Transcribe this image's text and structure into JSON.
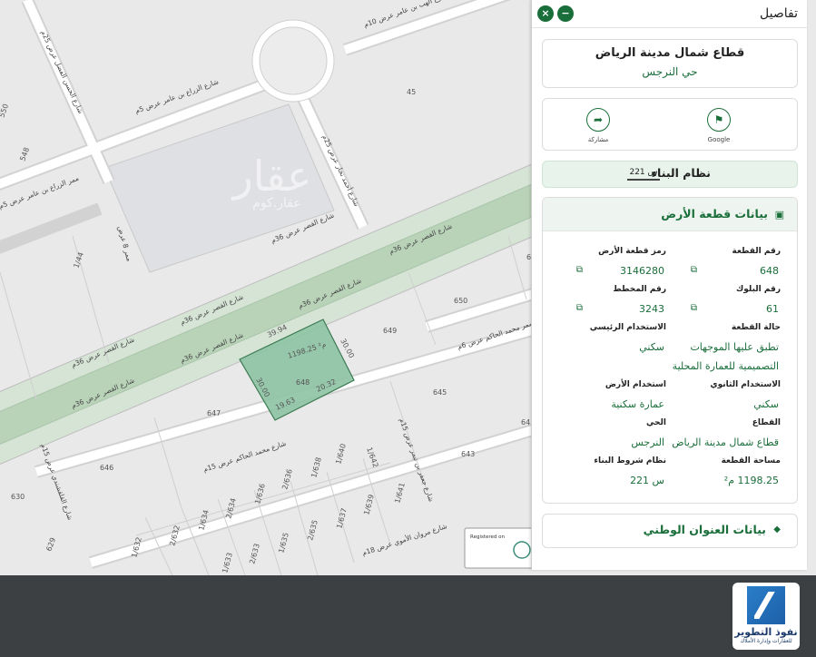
{
  "map": {
    "road_labels": {
      "qasr_1": "شارع القصر عرض 36م",
      "qasr_2": "شارع القصر عرض 36م",
      "qasr_3": "شارع القصر عرض 36م",
      "qasr_4": "شارع القصر عرض 36م",
      "qasr_5": "شارع القصر عرض 36م",
      "qasr_6": "شارع القصر عرض 36م",
      "qasr_7": "شارع القصر عرض 36م",
      "zarae_1": "شارع الزراع بن عامر عرض 5م",
      "zarae_2": "ممر الزراع بن عامر عرض 5م",
      "amir_10": "شارع الهب بن عامر عرض 10م",
      "hakim_1": "ممر محمد الحاكم عرض 6م",
      "hakim_15": "شارع محمد الحاكم عرض 15م",
      "ahmed_najar": "شارع أحمد نجار عرض 25م",
      "hassan_fadl": "شارع الحسن الفضل عرض 25م",
      "mamar_8": "ممر 8 عرض",
      "qalqashandi": "شارع القلقشندي عرض 15م",
      "jafar": "شارع جعفر بن تيمر عرض 15م",
      "marwan": "شارع مروان الأموي عرض 18م"
    },
    "plot_numbers": [
      "45",
      "550",
      "548",
      "1/44",
      "650",
      "649",
      "645",
      "643",
      "647",
      "646",
      "630",
      "629",
      "1/642",
      "1/640",
      "1/638",
      "2/636",
      "1/636",
      "1/634",
      "2/634",
      "1/632",
      "2/632",
      "1/633",
      "2/633",
      "1/635",
      "2/635",
      "1/637",
      "1/639",
      "1/641",
      "64",
      "63"
    ],
    "selected_parcel": {
      "number": "648",
      "area_label": "1198.25 م²",
      "dim_top": "39.94",
      "dim_right": "30.00",
      "dim_bottom": "20.32",
      "dim_bottom2": "19.63",
      "dim_left": "30.00"
    },
    "watermark": "عقار",
    "watermark_sub": "عقار.كوم",
    "badge_text": "Registered on"
  },
  "panel": {
    "title": "تفاصيل",
    "close_icon": "×",
    "minimize_icon": "−",
    "sector": "قطاع شمال مدينة الرياض",
    "district": "حي النرجس",
    "share_label": "مشاركة",
    "google_label": "Google",
    "building_system_label": "نظام البناء",
    "building_system_value": "س 221",
    "land_section_title": "بيانات قطعة الأرض",
    "fields": {
      "parcel_no_label": "رقم القطعة",
      "parcel_no": "648",
      "parcel_code_label": "رمز قطعة الأرض",
      "parcel_code": "3146280",
      "block_label": "رقم البلوك",
      "block": "61",
      "plan_label": "رقم المخطط",
      "plan": "3243",
      "status_label": "حالة القطعة",
      "status_line1": "تطبق عليها الموجهات",
      "status_line2": "التصميمية للعمارة المحلية",
      "main_use_label": "الاستخدام الرئيسي",
      "main_use": "سكني",
      "secondary_use_label": "الاستخدام الثانوي",
      "secondary_use": "سكني",
      "land_use_label": "استخدام الأرض",
      "land_use": "عمارة سكنية",
      "sector_label": "القطاع",
      "sector": "قطاع شمال مدينة الرياض",
      "district_label": "الحي",
      "district": "النرجس",
      "area_label": "مساحة القطعة",
      "area": "1198.25 م²",
      "conditions_label": "نظام شروط البناء",
      "conditions": "س 221"
    },
    "copy_icon": "⧉",
    "address_section_title": "بيانات العنوان الوطني"
  },
  "logo": {
    "name": "نفوذ التطوير",
    "tagline": "للعقارات وإدارة الأملاك"
  },
  "colors": {
    "accent_green": "#1a6e3a",
    "parcel_fill": "#8ec3a4",
    "main_road": "#cfe0cf"
  }
}
